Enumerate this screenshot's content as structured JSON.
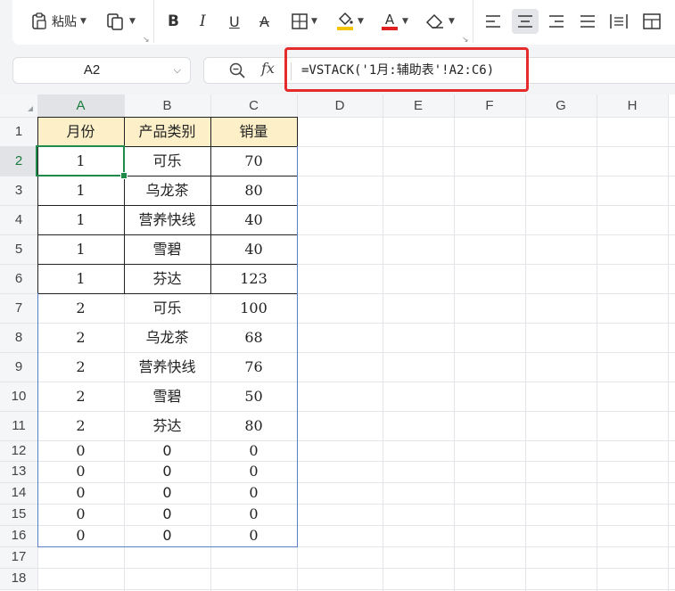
{
  "ribbon": {
    "paste_label": "粘贴"
  },
  "formula_bar": {
    "cell_ref": "A2",
    "fx_label": "fx",
    "formula": "=VSTACK('1月:辅助表'!A2:C6)"
  },
  "sheet": {
    "columns": [
      "A",
      "B",
      "C",
      "D",
      "E",
      "F",
      "G",
      "H"
    ],
    "rows": [
      "1",
      "2",
      "3",
      "4",
      "5",
      "6",
      "7",
      "8",
      "9",
      "10",
      "11",
      "12",
      "13",
      "14",
      "15",
      "16",
      "17",
      "18"
    ],
    "header": [
      "月份",
      "产品类别",
      "销量"
    ],
    "data": [
      [
        "1",
        "可乐",
        "70"
      ],
      [
        "1",
        "乌龙茶",
        "80"
      ],
      [
        "1",
        "营养快线",
        "40"
      ],
      [
        "1",
        "雪碧",
        "40"
      ],
      [
        "1",
        "芬达",
        "123"
      ],
      [
        "2",
        "可乐",
        "100"
      ],
      [
        "2",
        "乌龙茶",
        "68"
      ],
      [
        "2",
        "营养快线",
        "76"
      ],
      [
        "2",
        "雪碧",
        "50"
      ],
      [
        "2",
        "芬达",
        "80"
      ],
      [
        "0",
        "0",
        "0"
      ],
      [
        "0",
        "0",
        "0"
      ],
      [
        "0",
        "0",
        "0"
      ],
      [
        "0",
        "0",
        "0"
      ],
      [
        "0",
        "0",
        "0"
      ]
    ],
    "selected_cell": "A2"
  }
}
